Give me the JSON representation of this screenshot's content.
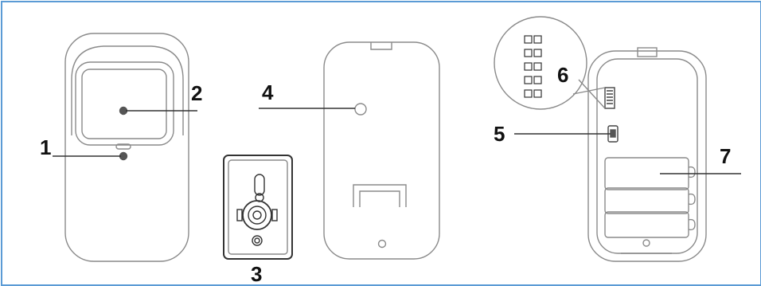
{
  "callouts": [
    {
      "id": "1",
      "label": "1"
    },
    {
      "id": "2",
      "label": "2"
    },
    {
      "id": "3",
      "label": "3"
    },
    {
      "id": "4",
      "label": "4"
    },
    {
      "id": "5",
      "label": "5"
    },
    {
      "id": "6",
      "label": "6"
    },
    {
      "id": "7",
      "label": "7"
    }
  ],
  "colors": {
    "frame": "#5b9bd5",
    "stroke": "#8a8a8a",
    "text": "#111111"
  }
}
